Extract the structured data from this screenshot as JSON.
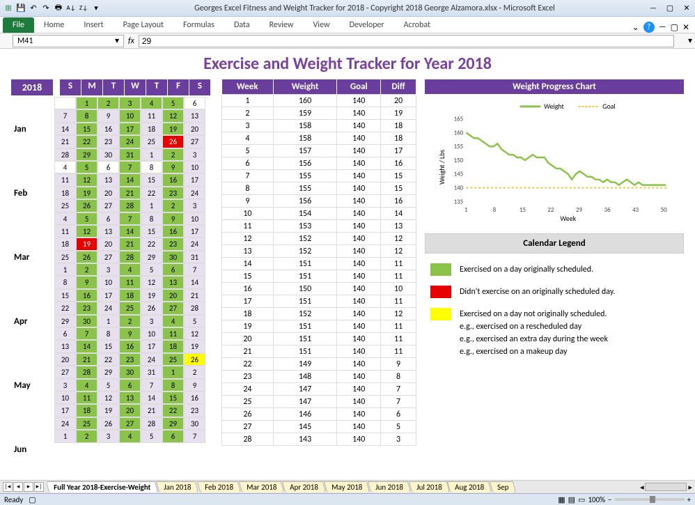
{
  "titlebar": {
    "title": "Georges Excel Fitness and Weight Tracker for 2018 - Copyright 2018 George Alzamora.xlsx  -  Microsoft Excel"
  },
  "ribbon": {
    "file": "File",
    "tabs": [
      "Home",
      "Insert",
      "Page Layout",
      "Formulas",
      "Data",
      "Review",
      "View",
      "Developer",
      "Acrobat"
    ]
  },
  "formula": {
    "namebox": "M41",
    "value": "29"
  },
  "page": {
    "title": "Exercise and Weight Tracker for Year 2018",
    "year": "2018"
  },
  "calendar": {
    "day_headers": [
      "S",
      "M",
      "T",
      "W",
      "T",
      "F",
      "S"
    ],
    "months": [
      "Jan",
      "Feb",
      "Mar",
      "Apr",
      "May",
      "Jun"
    ]
  },
  "weekTable": {
    "headers": [
      "Week",
      "Weight",
      "Goal",
      "Diff"
    ],
    "rows": [
      [
        1,
        160,
        140,
        20
      ],
      [
        2,
        159,
        140,
        19
      ],
      [
        3,
        158,
        140,
        18
      ],
      [
        4,
        158,
        140,
        18
      ],
      [
        5,
        157,
        140,
        17
      ],
      [
        6,
        156,
        140,
        16
      ],
      [
        7,
        155,
        140,
        15
      ],
      [
        8,
        155,
        140,
        15
      ],
      [
        9,
        156,
        140,
        16
      ],
      [
        10,
        154,
        140,
        14
      ],
      [
        11,
        153,
        140,
        13
      ],
      [
        12,
        152,
        140,
        12
      ],
      [
        13,
        152,
        140,
        12
      ],
      [
        14,
        151,
        140,
        11
      ],
      [
        15,
        151,
        140,
        11
      ],
      [
        16,
        150,
        140,
        10
      ],
      [
        17,
        151,
        140,
        11
      ],
      [
        18,
        152,
        140,
        12
      ],
      [
        19,
        151,
        140,
        11
      ],
      [
        20,
        151,
        140,
        11
      ],
      [
        21,
        151,
        140,
        11
      ],
      [
        22,
        149,
        140,
        9
      ],
      [
        23,
        148,
        140,
        8
      ],
      [
        24,
        147,
        140,
        7
      ],
      [
        25,
        147,
        140,
        7
      ],
      [
        26,
        146,
        140,
        6
      ],
      [
        27,
        145,
        140,
        5
      ],
      [
        28,
        143,
        140,
        3
      ]
    ]
  },
  "chart": {
    "title": "Weight Progress Chart",
    "legend": {
      "weight": "Weight",
      "goal": "Goal"
    },
    "ylabel": "Weight / Lbs"
  },
  "chart_data": {
    "type": "line",
    "title": "Weight Progress Chart",
    "xlabel": "Week",
    "ylabel": "Weight / Lbs",
    "ylim": [
      135,
      165
    ],
    "xticks": [
      1,
      8,
      15,
      22,
      29,
      36,
      43,
      50
    ],
    "series": [
      {
        "name": "Weight",
        "color": "#8bc34a",
        "values": [
          160,
          159,
          158,
          158,
          157,
          156,
          155,
          155,
          156,
          154,
          153,
          152,
          152,
          151,
          151,
          150,
          151,
          152,
          151,
          151,
          151,
          149,
          148,
          147,
          147,
          146,
          145,
          143,
          145,
          146,
          145,
          144,
          144,
          143,
          143,
          142,
          143,
          142,
          142,
          141,
          142,
          143,
          142,
          141,
          142,
          141,
          141,
          141,
          141,
          141,
          141,
          141
        ]
      },
      {
        "name": "Goal",
        "color": "#f1c232",
        "style": "dashed",
        "values": [
          140,
          140,
          140,
          140,
          140,
          140,
          140,
          140,
          140,
          140,
          140,
          140,
          140,
          140,
          140,
          140,
          140,
          140,
          140,
          140,
          140,
          140,
          140,
          140,
          140,
          140,
          140,
          140,
          140,
          140,
          140,
          140,
          140,
          140,
          140,
          140,
          140,
          140,
          140,
          140,
          140,
          140,
          140,
          140,
          140,
          140,
          140,
          140,
          140,
          140,
          140,
          140
        ]
      }
    ]
  },
  "legend": {
    "title": "Calendar Legend",
    "items": [
      {
        "color": "#8bc34a",
        "text": "Exercised on a day originally scheduled."
      },
      {
        "color": "#e60000",
        "text": "Didn't exercise on an originally scheduled day."
      },
      {
        "color": "#ffff00",
        "text": "Exercised on a day not originally scheduled.\ne.g., exercised on a rescheduled day\ne.g., exercised an extra day during the week\ne.g., exercised on a makeup day"
      }
    ]
  },
  "sheetTabs": [
    "Full Year 2018-Exercise-Weight",
    "Jan 2018",
    "Feb 2018",
    "Mar 2018",
    "Apr 2018",
    "May 2018",
    "Jun 2018",
    "Jul 2018",
    "Aug 2018",
    "Sep"
  ],
  "status": {
    "ready": "Ready",
    "zoom": "100%"
  }
}
